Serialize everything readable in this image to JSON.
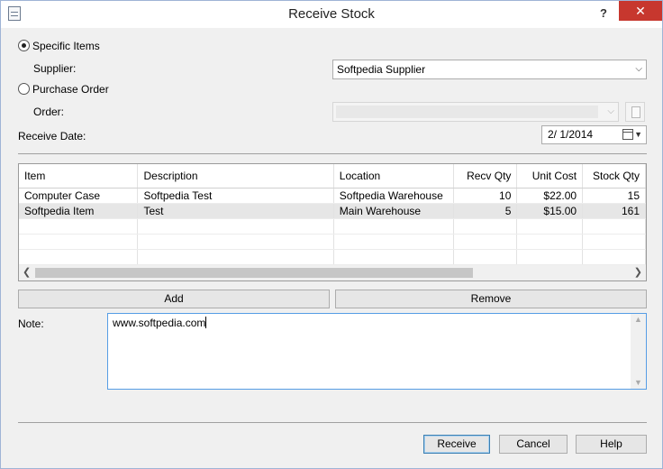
{
  "window": {
    "title": "Receive Stock",
    "help_glyph": "?",
    "close_glyph": "✕"
  },
  "options": {
    "specific_items": "Specific Items",
    "supplier_label": "Supplier:",
    "supplier_value": "Softpedia Supplier",
    "purchase_order": "Purchase Order",
    "order_label": "Order:",
    "order_value": "",
    "selected": "specific_items"
  },
  "receive_date": {
    "label": "Receive Date:",
    "value": "2/  1/2014"
  },
  "grid": {
    "columns": [
      "Item",
      "Description",
      "Location",
      "Recv Qty",
      "Unit Cost",
      "Stock Qty"
    ],
    "rows": [
      [
        "Computer Case",
        "Softpedia Test",
        "Softpedia Warehouse",
        "10",
        "$22.00",
        "15"
      ],
      [
        "Softpedia Item",
        "Test",
        "Main Warehouse",
        "5",
        "$15.00",
        "161"
      ]
    ],
    "selected_row": 1
  },
  "actions": {
    "add": "Add",
    "remove": "Remove"
  },
  "note": {
    "label": "Note:",
    "value": "www.softpedia.com"
  },
  "footer": {
    "receive": "Receive",
    "cancel": "Cancel",
    "help": "Help"
  },
  "icons": {
    "combo_arrow": "chevron-down-icon",
    "calendar": "calendar-icon"
  },
  "colors": {
    "close": "#c7372e",
    "focus_border": "#569de5",
    "selected_row": "#e6e6e6"
  }
}
